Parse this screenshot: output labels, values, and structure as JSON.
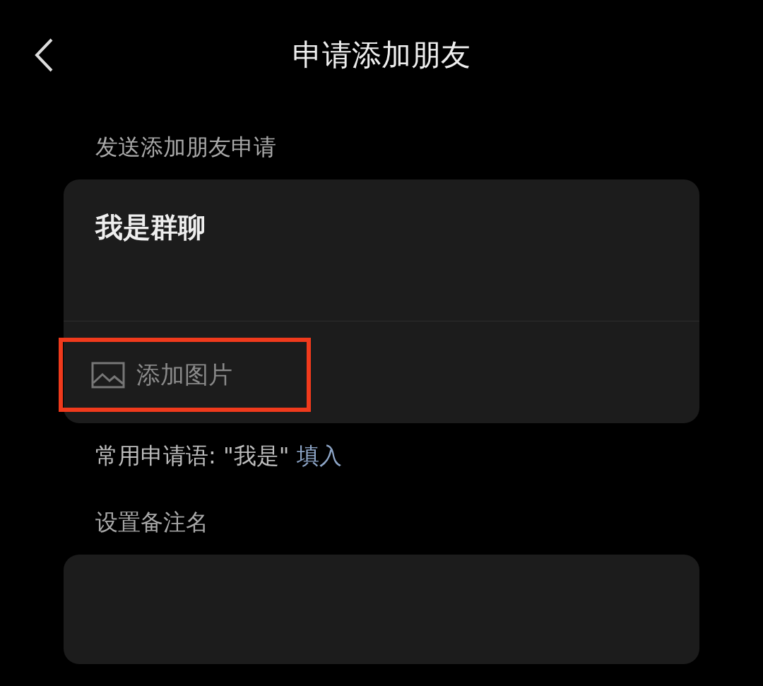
{
  "header": {
    "title": "申请添加朋友"
  },
  "request_section": {
    "label": "发送添加朋友申请",
    "message": "我是群聊",
    "add_image": {
      "label": "添加图片",
      "highlighted": true
    }
  },
  "common_phrase": {
    "text": "常用申请语: \"我是\"",
    "link": "填入"
  },
  "remark_section": {
    "label": "设置备注名"
  }
}
